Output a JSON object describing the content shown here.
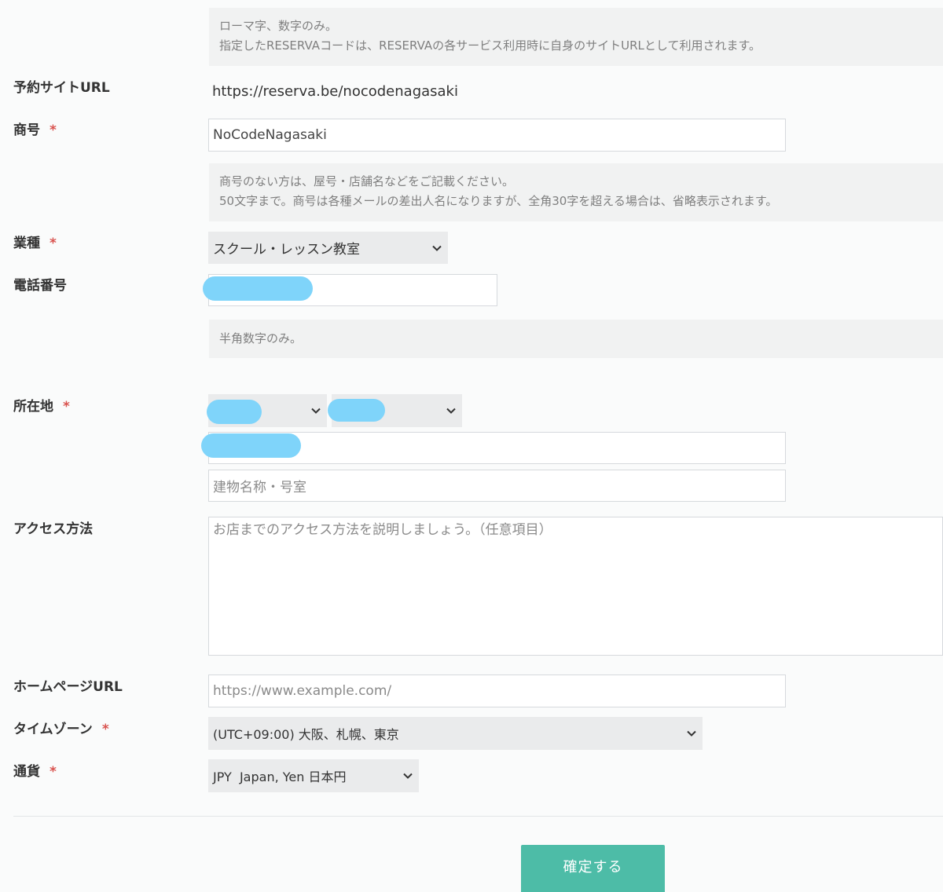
{
  "help": {
    "code_line1": "ローマ字、数字のみ。",
    "code_line2": "指定したRESERVAコードは、RESERVAの各サービス利用時に自身のサイトURLとして利用されます。",
    "name_line1": "商号のない方は、屋号・店舗名などをご記載ください。",
    "name_line2": "50文字まで。商号は各種メールの差出人名になりますが、全角30字を超える場合は、省略表示されます。",
    "phone": "半角数字のみ。"
  },
  "fields": {
    "site_url_label": "予約サイトURL",
    "site_url_value": "https://reserva.be/nocodenagasaki",
    "name_label": "商号",
    "name_value": "NoCodeNagasaki",
    "industry_label": "業種",
    "industry_value": "スクール・レッスン教室",
    "phone_label": "電話番号",
    "address_label": "所在地",
    "building_placeholder": "建物名称・号室",
    "access_label": "アクセス方法",
    "access_placeholder": "お店までのアクセス方法を説明しましょう。（任意項目）",
    "homepage_label": "ホームページURL",
    "homepage_placeholder": "https://www.example.com/",
    "timezone_label": "タイムゾーン",
    "timezone_value": "(UTC+09:00) 大阪、札幌、東京",
    "currency_label": "通貨",
    "currency_value": "JPY  Japan, Yen 日本円"
  },
  "required_mark": "*",
  "submit_label": "確定する",
  "colors": {
    "accent": "#4dbca7",
    "required": "#d9534f",
    "redaction": "#7fd4fa"
  }
}
